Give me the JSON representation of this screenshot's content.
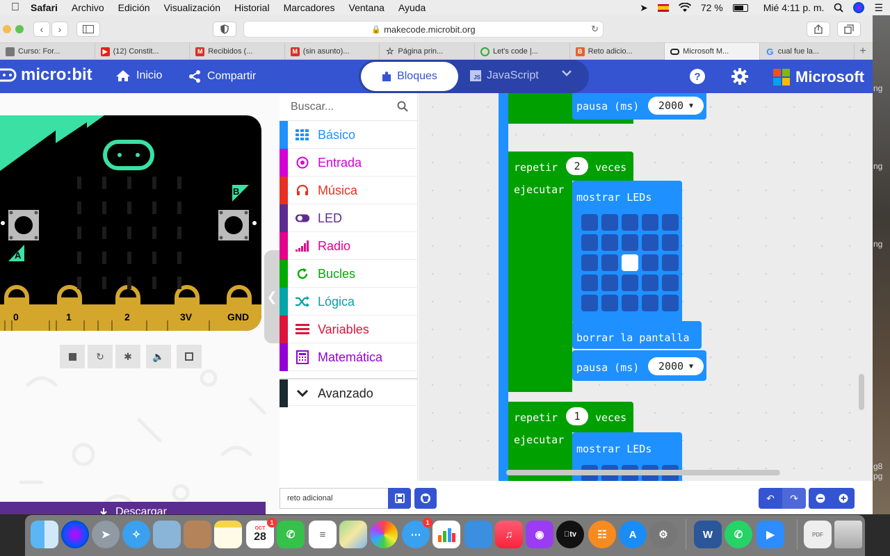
{
  "menubar": {
    "app": "Safari",
    "items": [
      "Archivo",
      "Edición",
      "Visualización",
      "Historial",
      "Marcadores",
      "Ventana",
      "Ayuda"
    ],
    "battery": "72 %",
    "clock": "Mié 4:11 p. m."
  },
  "browser": {
    "url": "makecode.microbit.org",
    "tabs": [
      {
        "label": "Curso: For...",
        "color": "#555555"
      },
      {
        "label": "(12) Constit...",
        "color": "#e62117"
      },
      {
        "label": "Recibidos (...",
        "color": "#d93025"
      },
      {
        "label": "(sin asunto)...",
        "color": "#d93025"
      },
      {
        "label": "Página prin...",
        "color": "#444444"
      },
      {
        "label": "Let's code |...",
        "color": "#33aa33"
      },
      {
        "label": "Reto adicio...",
        "color": "#e8612c"
      },
      {
        "label": "Microsoft M...",
        "color": "#222222"
      },
      {
        "label": "cual fue la...",
        "color": "#4285f4"
      }
    ]
  },
  "header": {
    "logo": "micro:bit",
    "home": "Inicio",
    "share": "Compartir",
    "blocks": "Bloques",
    "javascript": "JavaScript",
    "microsoft": "Microsoft"
  },
  "simulator": {
    "pins": [
      "0",
      "1",
      "2",
      "3V",
      "GND"
    ],
    "button_a": "A",
    "button_b": "B",
    "download": "Descargar"
  },
  "toolbox": {
    "search_placeholder": "Buscar...",
    "categories": [
      {
        "label": "Básico",
        "color": "#1e90ff"
      },
      {
        "label": "Entrada",
        "color": "#d400d4"
      },
      {
        "label": "Música",
        "color": "#e63022"
      },
      {
        "label": "LED",
        "color": "#5c2d91"
      },
      {
        "label": "Radio",
        "color": "#e3008c"
      },
      {
        "label": "Bucles",
        "color": "#00aa00"
      },
      {
        "label": "Lógica",
        "color": "#00a4a6"
      },
      {
        "label": "Variables",
        "color": "#dc143c"
      },
      {
        "label": "Matemática",
        "color": "#9400d3"
      }
    ],
    "advanced": "Avanzado"
  },
  "workspace": {
    "pause1": {
      "label": "pausa (ms)",
      "value": "2000"
    },
    "repeat1": {
      "label": "repetir",
      "count": "2",
      "suffix": "veces",
      "do": "ejecutar"
    },
    "show_leds1": "mostrar LEDs",
    "leds1_on": [
      12
    ],
    "clear": "borrar la pantalla",
    "pause2": {
      "label": "pausa (ms)",
      "value": "2000"
    },
    "repeat2": {
      "label": "repetir",
      "count": "1",
      "suffix": "veces",
      "do": "ejecutar"
    },
    "show_leds2": "mostrar LEDs"
  },
  "bottombar": {
    "project_name": "reto adicional"
  },
  "desktop_labels": [
    "ng",
    "ng",
    "ng",
    "g8",
    "pg"
  ],
  "dock": {
    "calendar_month": "OCT",
    "calendar_day": "28",
    "apps": [
      "Finder",
      "Siri",
      "Launchpad",
      "Safari",
      "Preview",
      "Contacts",
      "Notes",
      "Calendar",
      "FaceTime",
      "Reminders",
      "Maps",
      "Photos",
      "Messages",
      "Numbers",
      "Keynote",
      "Music",
      "Podcasts",
      "TV",
      "Books",
      "App Store",
      "System Preferences",
      "Word",
      "WhatsApp",
      "Zoom",
      "PDF",
      "Trash"
    ]
  },
  "colors": {
    "header": "#3454d1",
    "loops_green": "#00a000",
    "basic_blue": "#1e90ff"
  }
}
